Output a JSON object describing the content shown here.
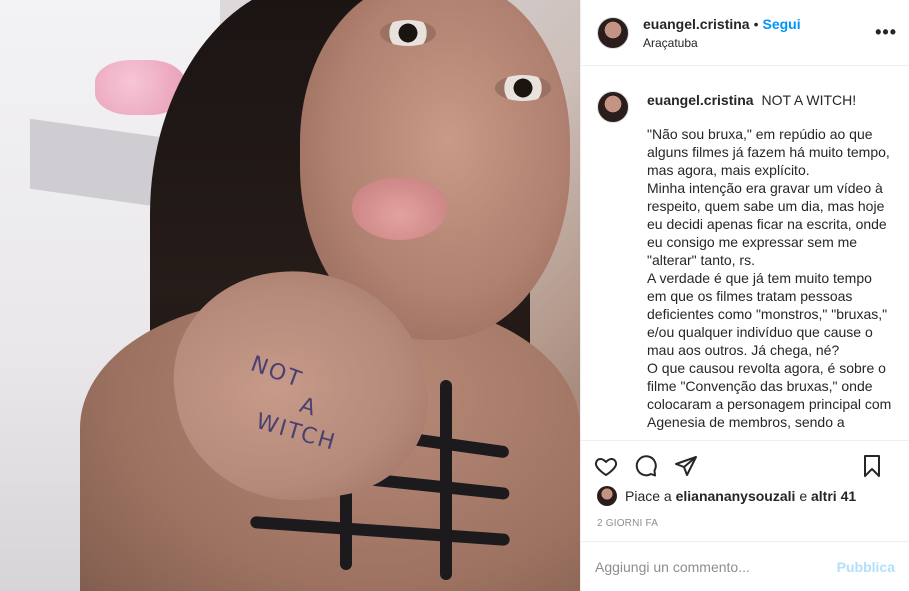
{
  "post": {
    "username": "euangel.cristina",
    "separator": "•",
    "follow_label": "Segui",
    "location": "Araçatuba",
    "more_label": "•••",
    "photo_ink": [
      "NOT",
      "A",
      "WITCH"
    ]
  },
  "caption": {
    "username": "euangel.cristina",
    "title": "NOT A WITCH!",
    "paragraphs": [
      "\"Não sou bruxa,\" em repúdio ao que alguns filmes já fazem há muito tempo, mas agora, mais explícito.",
      "Minha intenção era gravar um vídeo à respeito, quem sabe um dia, mas hoje eu decidi apenas ficar na escrita, onde eu consigo me expressar sem me \"alterar\" tanto, rs.",
      "A verdade é que já tem muito tempo em que os filmes tratam pessoas deficientes como \"monstros,\" \"bruxas,\" e/ou qualquer indivíduo que cause o mau aos outros. Já chega, né?",
      "O que causou revolta agora, é sobre o filme \"Convenção das bruxas,\" onde colocaram a personagem principal com Agenesia de membros, sendo a"
    ]
  },
  "likes": {
    "prefix": "Piace a",
    "user": "eliananany souzali",
    "user_display": "elianananysouzali",
    "connector": "e",
    "others": "altri 41"
  },
  "timestamp": "2 GIORNI FA",
  "comment": {
    "placeholder": "Aggiungi un commento...",
    "publish_label": "Pubblica"
  },
  "icons": {
    "like": "heart-icon",
    "comment": "comment-icon",
    "share": "send-icon",
    "save": "bookmark-icon",
    "more": "more-options-icon"
  },
  "colors": {
    "follow": "#0095f6",
    "publish_disabled": "#b2dffc",
    "secondary_text": "#8e8e8e",
    "border": "#efefef"
  }
}
